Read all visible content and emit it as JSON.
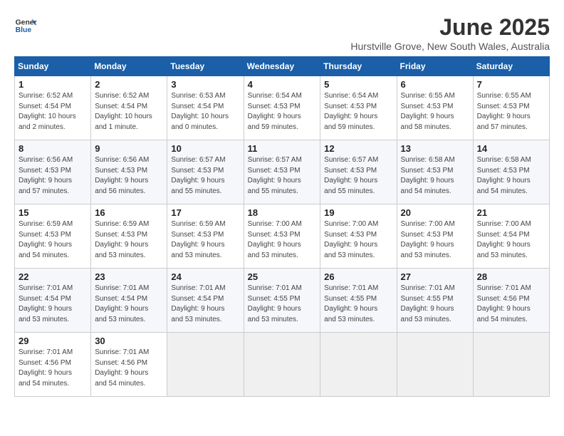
{
  "logo": {
    "line1": "General",
    "line2": "Blue"
  },
  "title": "June 2025",
  "subtitle": "Hurstville Grove, New South Wales, Australia",
  "weekdays": [
    "Sunday",
    "Monday",
    "Tuesday",
    "Wednesday",
    "Thursday",
    "Friday",
    "Saturday"
  ],
  "weeks": [
    [
      {
        "day": "1",
        "info": "Sunrise: 6:52 AM\nSunset: 4:54 PM\nDaylight: 10 hours\nand 2 minutes."
      },
      {
        "day": "2",
        "info": "Sunrise: 6:52 AM\nSunset: 4:54 PM\nDaylight: 10 hours\nand 1 minute."
      },
      {
        "day": "3",
        "info": "Sunrise: 6:53 AM\nSunset: 4:54 PM\nDaylight: 10 hours\nand 0 minutes."
      },
      {
        "day": "4",
        "info": "Sunrise: 6:54 AM\nSunset: 4:53 PM\nDaylight: 9 hours\nand 59 minutes."
      },
      {
        "day": "5",
        "info": "Sunrise: 6:54 AM\nSunset: 4:53 PM\nDaylight: 9 hours\nand 59 minutes."
      },
      {
        "day": "6",
        "info": "Sunrise: 6:55 AM\nSunset: 4:53 PM\nDaylight: 9 hours\nand 58 minutes."
      },
      {
        "day": "7",
        "info": "Sunrise: 6:55 AM\nSunset: 4:53 PM\nDaylight: 9 hours\nand 57 minutes."
      }
    ],
    [
      {
        "day": "8",
        "info": "Sunrise: 6:56 AM\nSunset: 4:53 PM\nDaylight: 9 hours\nand 57 minutes."
      },
      {
        "day": "9",
        "info": "Sunrise: 6:56 AM\nSunset: 4:53 PM\nDaylight: 9 hours\nand 56 minutes."
      },
      {
        "day": "10",
        "info": "Sunrise: 6:57 AM\nSunset: 4:53 PM\nDaylight: 9 hours\nand 55 minutes."
      },
      {
        "day": "11",
        "info": "Sunrise: 6:57 AM\nSunset: 4:53 PM\nDaylight: 9 hours\nand 55 minutes."
      },
      {
        "day": "12",
        "info": "Sunrise: 6:57 AM\nSunset: 4:53 PM\nDaylight: 9 hours\nand 55 minutes."
      },
      {
        "day": "13",
        "info": "Sunrise: 6:58 AM\nSunset: 4:53 PM\nDaylight: 9 hours\nand 54 minutes."
      },
      {
        "day": "14",
        "info": "Sunrise: 6:58 AM\nSunset: 4:53 PM\nDaylight: 9 hours\nand 54 minutes."
      }
    ],
    [
      {
        "day": "15",
        "info": "Sunrise: 6:59 AM\nSunset: 4:53 PM\nDaylight: 9 hours\nand 54 minutes."
      },
      {
        "day": "16",
        "info": "Sunrise: 6:59 AM\nSunset: 4:53 PM\nDaylight: 9 hours\nand 53 minutes."
      },
      {
        "day": "17",
        "info": "Sunrise: 6:59 AM\nSunset: 4:53 PM\nDaylight: 9 hours\nand 53 minutes."
      },
      {
        "day": "18",
        "info": "Sunrise: 7:00 AM\nSunset: 4:53 PM\nDaylight: 9 hours\nand 53 minutes."
      },
      {
        "day": "19",
        "info": "Sunrise: 7:00 AM\nSunset: 4:53 PM\nDaylight: 9 hours\nand 53 minutes."
      },
      {
        "day": "20",
        "info": "Sunrise: 7:00 AM\nSunset: 4:53 PM\nDaylight: 9 hours\nand 53 minutes."
      },
      {
        "day": "21",
        "info": "Sunrise: 7:00 AM\nSunset: 4:54 PM\nDaylight: 9 hours\nand 53 minutes."
      }
    ],
    [
      {
        "day": "22",
        "info": "Sunrise: 7:01 AM\nSunset: 4:54 PM\nDaylight: 9 hours\nand 53 minutes."
      },
      {
        "day": "23",
        "info": "Sunrise: 7:01 AM\nSunset: 4:54 PM\nDaylight: 9 hours\nand 53 minutes."
      },
      {
        "day": "24",
        "info": "Sunrise: 7:01 AM\nSunset: 4:54 PM\nDaylight: 9 hours\nand 53 minutes."
      },
      {
        "day": "25",
        "info": "Sunrise: 7:01 AM\nSunset: 4:55 PM\nDaylight: 9 hours\nand 53 minutes."
      },
      {
        "day": "26",
        "info": "Sunrise: 7:01 AM\nSunset: 4:55 PM\nDaylight: 9 hours\nand 53 minutes."
      },
      {
        "day": "27",
        "info": "Sunrise: 7:01 AM\nSunset: 4:55 PM\nDaylight: 9 hours\nand 53 minutes."
      },
      {
        "day": "28",
        "info": "Sunrise: 7:01 AM\nSunset: 4:56 PM\nDaylight: 9 hours\nand 54 minutes."
      }
    ],
    [
      {
        "day": "29",
        "info": "Sunrise: 7:01 AM\nSunset: 4:56 PM\nDaylight: 9 hours\nand 54 minutes."
      },
      {
        "day": "30",
        "info": "Sunrise: 7:01 AM\nSunset: 4:56 PM\nDaylight: 9 hours\nand 54 minutes."
      },
      {
        "day": "",
        "info": ""
      },
      {
        "day": "",
        "info": ""
      },
      {
        "day": "",
        "info": ""
      },
      {
        "day": "",
        "info": ""
      },
      {
        "day": "",
        "info": ""
      }
    ]
  ]
}
